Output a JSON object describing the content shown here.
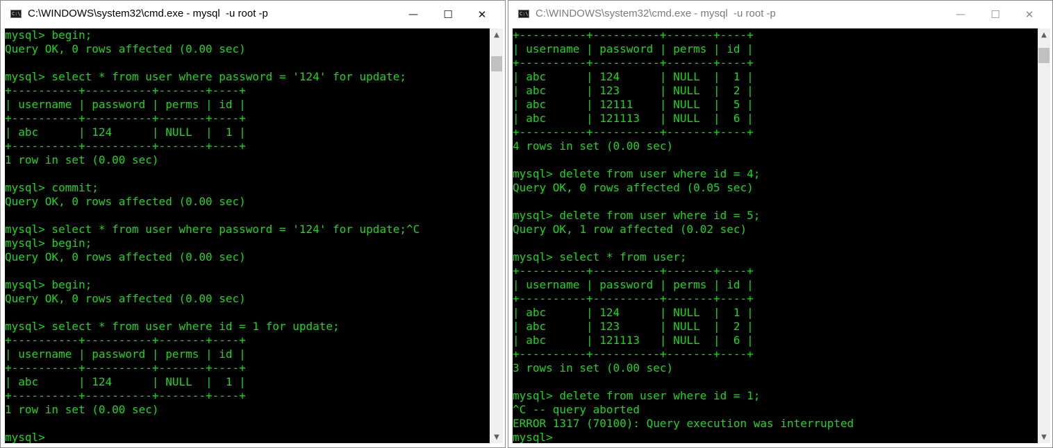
{
  "windows": {
    "left": {
      "title": "C:\\WINDOWS\\system32\\cmd.exe - mysql  -u root -p",
      "icon_glyph": "C:\\",
      "controls": {
        "minimize": "—",
        "maximize": "☐",
        "close": "✕"
      },
      "console_text": "mysql> begin;\nQuery OK, 0 rows affected (0.00 sec)\n\nmysql> select * from user where password = '124' for update;\n+----------+----------+-------+----+\n| username | password | perms | id |\n+----------+----------+-------+----+\n| abc      | 124      | NULL  |  1 |\n+----------+----------+-------+----+\n1 row in set (0.00 sec)\n\nmysql> commit;\nQuery OK, 0 rows affected (0.00 sec)\n\nmysql> select * from user where password = '124' for update;^C\nmysql> begin;\nQuery OK, 0 rows affected (0.00 sec)\n\nmysql> begin;\nQuery OK, 0 rows affected (0.00 sec)\n\nmysql> select * from user where id = 1 for update;\n+----------+----------+-------+----+\n| username | password | perms | id |\n+----------+----------+-------+----+\n| abc      | 124      | NULL  |  1 |\n+----------+----------+-------+----+\n1 row in set (0.00 sec)\n\nmysql>"
    },
    "right": {
      "title": "C:\\WINDOWS\\system32\\cmd.exe - mysql  -u root -p",
      "icon_glyph": "C:\\",
      "controls": {
        "minimize": "—",
        "maximize": "☐",
        "close": "✕"
      },
      "console_text": "+----------+----------+-------+----+\n| username | password | perms | id |\n+----------+----------+-------+----+\n| abc      | 124      | NULL  |  1 |\n| abc      | 123      | NULL  |  2 |\n| abc      | 12111    | NULL  |  5 |\n| abc      | 121113   | NULL  |  6 |\n+----------+----------+-------+----+\n4 rows in set (0.00 sec)\n\nmysql> delete from user where id = 4;\nQuery OK, 0 rows affected (0.05 sec)\n\nmysql> delete from user where id = 5;\nQuery OK, 1 row affected (0.02 sec)\n\nmysql> select * from user;\n+----------+----------+-------+----+\n| username | password | perms | id |\n+----------+----------+-------+----+\n| abc      | 124      | NULL  |  1 |\n| abc      | 123      | NULL  |  2 |\n| abc      | 121113   | NULL  |  6 |\n+----------+----------+-------+----+\n3 rows in set (0.00 sec)\n\nmysql> delete from user where id = 1;\n^C -- query aborted\nERROR 1317 (70100): Query execution was interrupted\nmysql>"
    }
  },
  "colors": {
    "console_background": "#000000",
    "console_text": "#19d919",
    "inactive_title": "#7b7b7b"
  },
  "icons": {
    "app": "cmd-app-icon",
    "scroll_up": "chevron-up-icon",
    "scroll_down": "chevron-down-icon"
  }
}
